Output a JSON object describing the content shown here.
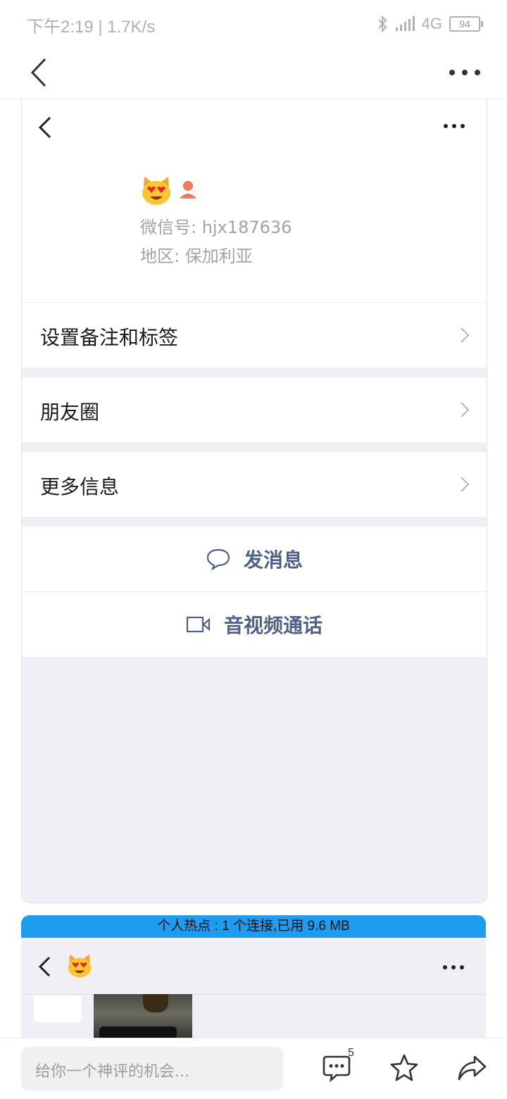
{
  "status_bar": {
    "time_speed": "下午2:19 | 1.7K/s",
    "network": "4G",
    "battery": "94"
  },
  "profile": {
    "wechat_id": "微信号: hjx187636",
    "region": "地区: 保加利亚"
  },
  "menu": {
    "remark": "设置备注和标签",
    "moments": "朋友圈",
    "more_info": "更多信息"
  },
  "actions": {
    "send_message": "发消息",
    "video_call": "音视频通话"
  },
  "hotspot_banner": "个人热点 : 1 个连接,已用 9.6 MB",
  "bottom_bar": {
    "comment_placeholder": "给你一个神评的机会...",
    "comment_count": "5"
  },
  "icons": {
    "back": "chevron-left-icon",
    "more": "more-dots-icon",
    "emoji": "heart-eyes-cat-emoji",
    "message": "chat-bubble-icon",
    "video": "video-camera-icon",
    "comment": "comment-icon",
    "favorite": "star-icon",
    "share": "share-icon"
  },
  "colors": {
    "action_text": "#4f6186",
    "hotspot_banner": "#1e9df0",
    "card_bg": "#f2eef6"
  }
}
